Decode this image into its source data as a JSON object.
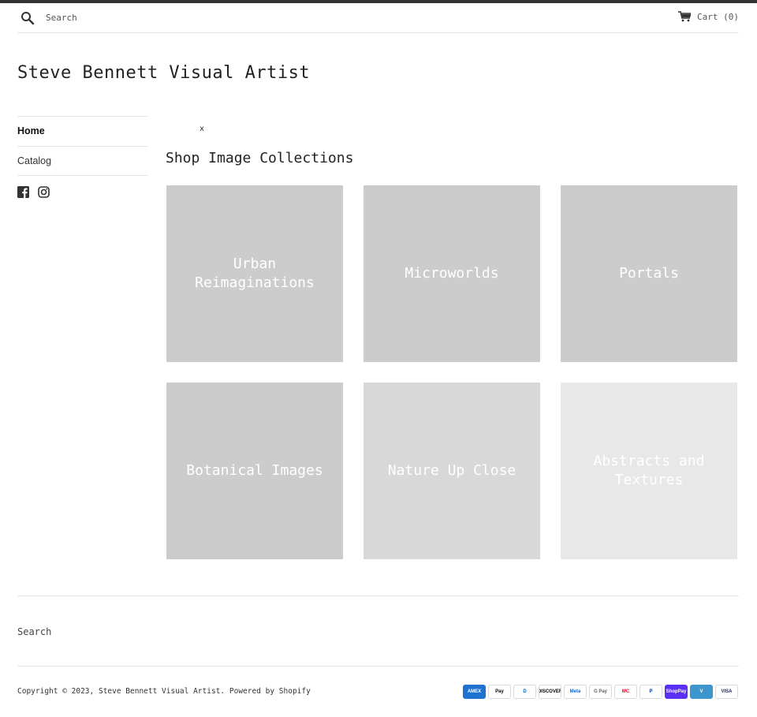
{
  "header": {
    "search_placeholder": "Search",
    "cart_label": "Cart",
    "cart_count": "(0)"
  },
  "site_title": "Steve Bennett Visual Artist",
  "nav": {
    "items": [
      {
        "label": "Home",
        "active": true
      },
      {
        "label": "Catalog",
        "active": false
      }
    ]
  },
  "social": [
    "facebook-icon",
    "instagram-icon"
  ],
  "stray_glyph": "x",
  "collections": {
    "title": "Shop Image Collections",
    "items": [
      {
        "label": "Urban Reimaginations",
        "color": "#cccccc"
      },
      {
        "label": "Microworlds",
        "color": "#cccccc"
      },
      {
        "label": "Portals",
        "color": "#cccccc"
      },
      {
        "label": "Botanical Images",
        "color": "#cccccc"
      },
      {
        "label": "Nature Up Close",
        "color": "#d8d8d8"
      },
      {
        "label": "Abstracts and Textures",
        "color": "#e8e8e8"
      }
    ]
  },
  "footer": {
    "search_link": "Search",
    "copyright_prefix": "Copyright © 2023,",
    "copyright_site": "Steve Bennett Visual Artist",
    "powered_by": "Powered by Shopify",
    "payment_methods": [
      {
        "name": "AMEX",
        "bg": "#1f72cd",
        "fg": "#ffffff"
      },
      {
        "name": "Pay",
        "bg": "#ffffff",
        "fg": "#000000"
      },
      {
        "name": "D",
        "bg": "#ffffff",
        "fg": "#0165ac"
      },
      {
        "name": "DISCOVER",
        "bg": "#ffffff",
        "fg": "#000000"
      },
      {
        "name": "Meta",
        "bg": "#ffffff",
        "fg": "#0668e1"
      },
      {
        "name": "G Pay",
        "bg": "#ffffff",
        "fg": "#5f6368"
      },
      {
        "name": "MC",
        "bg": "#ffffff",
        "fg": "#eb001b"
      },
      {
        "name": "P",
        "bg": "#ffffff",
        "fg": "#003087"
      },
      {
        "name": "ShopPay",
        "bg": "#5a31f4",
        "fg": "#ffffff"
      },
      {
        "name": "V",
        "bg": "#3d95ce",
        "fg": "#ffffff"
      },
      {
        "name": "VISA",
        "bg": "#ffffff",
        "fg": "#1a1f71"
      }
    ]
  }
}
